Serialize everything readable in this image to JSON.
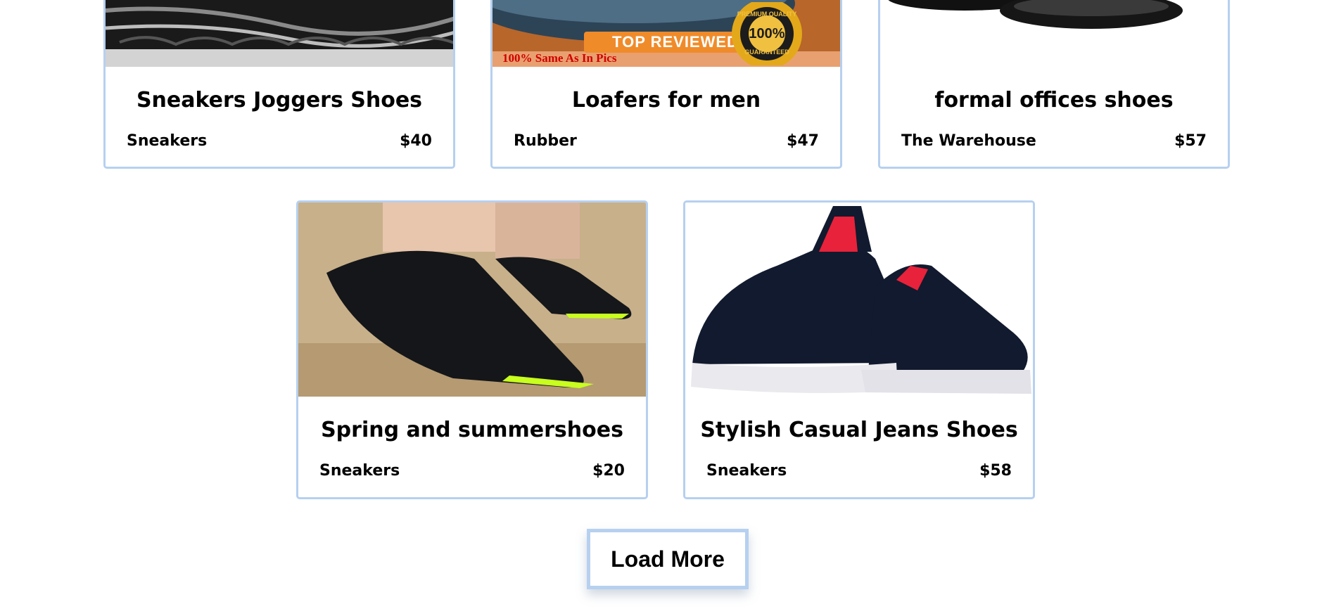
{
  "products": [
    {
      "title": "Sneakers Joggers Shoes",
      "category": "Sneakers",
      "price": "$40",
      "image": "black-sneaker-sole-image"
    },
    {
      "title": "Loafers for men",
      "category": "Rubber",
      "price": "$47",
      "image": "blue-loafer-image",
      "badge": {
        "banner": "TOP REVIEWED",
        "seal_top": "PREMIUM QUALITY",
        "seal_center": "100%",
        "seal_bottom": "GUARANTEED",
        "footer": "100% Same As In Pics"
      }
    },
    {
      "title": "formal offices shoes",
      "category": "The Warehouse",
      "price": "$57",
      "image": "black-formal-shoe-image"
    },
    {
      "title": "Spring and summershoes",
      "category": "Sneakers",
      "price": "$20",
      "image": "black-water-shoe-on-sand-image"
    },
    {
      "title": "Stylish Casual Jeans Shoes",
      "category": "Sneakers",
      "price": "$58",
      "image": "navy-slip-on-shoe-image"
    }
  ],
  "load_more": {
    "label": "Load More"
  },
  "colors": {
    "card_border": "#b6d0ef",
    "text": "#000000",
    "background": "#ffffff"
  }
}
